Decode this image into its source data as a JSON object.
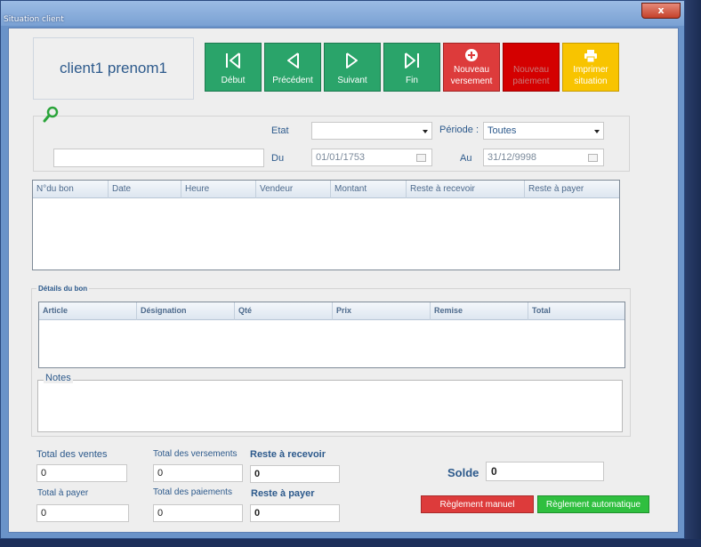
{
  "window": {
    "title": "Situation client",
    "close_label": "x"
  },
  "client": {
    "name": "client1 prenom1"
  },
  "nav": {
    "debut": "Début",
    "precedent": "Précédent",
    "suivant": "Suivant",
    "fin": "Fin",
    "nouveau_versement": [
      "Nouveau",
      "versement"
    ],
    "nouveau_paiement": [
      "Nouveau",
      "paiement"
    ],
    "imprimer_situation": [
      "Imprimer",
      "situation"
    ]
  },
  "filters": {
    "etat_label": "Etat",
    "etat_value": "",
    "periode_label": "Période :",
    "periode_value": "Toutes",
    "du_label": "Du",
    "du_value": "01/01/1753",
    "au_label": "Au",
    "au_value": "31/12/9998",
    "search_value": ""
  },
  "bons_table": {
    "columns": [
      "N°du bon",
      "Date",
      "Heure",
      "Vendeur",
      "Montant",
      "Reste à recevoir",
      "Reste à payer"
    ]
  },
  "details": {
    "title": "Détails du bon",
    "columns": [
      "Article",
      "Désignation",
      "Qté",
      "Prix",
      "Remise",
      "Total"
    ],
    "notes_label": "Notes"
  },
  "totals": {
    "total_ventes_label": "Total des ventes",
    "total_ventes": "0",
    "total_versements_label": "Total des versements",
    "total_versements": "0",
    "reste_recevoir_label": "Reste à recevoir",
    "reste_recevoir": "0",
    "total_payer_label": "Total à payer",
    "total_payer": "0",
    "total_paiements_label": "Total des paiements",
    "total_paiements": "0",
    "reste_payer_label": "Reste à payer",
    "reste_payer": "0",
    "solde_label": "Solde",
    "solde": "0"
  },
  "actions": {
    "reglement_manuel": "Règlement manuel",
    "reglement_auto": "Règlement automatique"
  },
  "colors": {
    "nav_green": "#2aa46a",
    "red": "#dd3b3b",
    "dark_red": "#d40000",
    "yellow": "#f8c400",
    "green_button": "#2fbf3f",
    "label_blue": "#2d5a8c"
  }
}
